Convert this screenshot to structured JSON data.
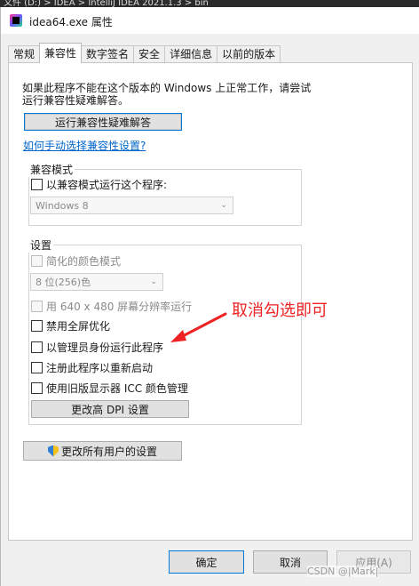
{
  "taskbar": {
    "text": "文件 (D:)  >  IDEA  >  IntelliJ IDEA 2021.1.3  >  bin"
  },
  "window": {
    "title": "idea64.exe 属性"
  },
  "tabs": [
    {
      "label": "常规",
      "active": false
    },
    {
      "label": "兼容性",
      "active": true
    },
    {
      "label": "数字签名",
      "active": false
    },
    {
      "label": "安全",
      "active": false
    },
    {
      "label": "详细信息",
      "active": false
    },
    {
      "label": "以前的版本",
      "active": false
    }
  ],
  "compatibility": {
    "intro_line1": "如果此程序不能在这个版本的 Windows 上正常工作，请尝试",
    "intro_line2": "运行兼容性疑难解答。",
    "troubleshoot_button": "运行兼容性疑难解答",
    "manual_link": "如何手动选择兼容性设置?",
    "compat_mode": {
      "group_label": "兼容模式",
      "checkbox_label": "以兼容模式运行这个程序:",
      "checked": false,
      "os_select": "Windows 8"
    },
    "settings": {
      "group_label": "设置",
      "reduced_color": {
        "label": "简化的颜色模式",
        "checked": false,
        "enabled": false
      },
      "color_select": "8 位(256)色",
      "res_640": {
        "label": "用 640 x 480 屏幕分辨率运行",
        "checked": false,
        "enabled": false
      },
      "disable_fullscreen": {
        "label": "禁用全屏优化",
        "checked": false,
        "enabled": true
      },
      "run_as_admin": {
        "label": "以管理员身份运行此程序",
        "checked": false,
        "enabled": true
      },
      "register_restart": {
        "label": "注册此程序以重新启动",
        "checked": false,
        "enabled": true
      },
      "legacy_icc": {
        "label": "使用旧版显示器 ICC 颜色管理",
        "checked": false,
        "enabled": true
      },
      "dpi_button": "更改高 DPI 设置"
    },
    "all_users_button": "更改所有用户的设置"
  },
  "annotation": {
    "text": "取消勾选即可",
    "color": "#ee2222"
  },
  "footer": {
    "ok": "确定",
    "cancel": "取消",
    "apply": "应用(A)"
  },
  "watermark": {
    "text": "CSDN @|Mark|"
  }
}
